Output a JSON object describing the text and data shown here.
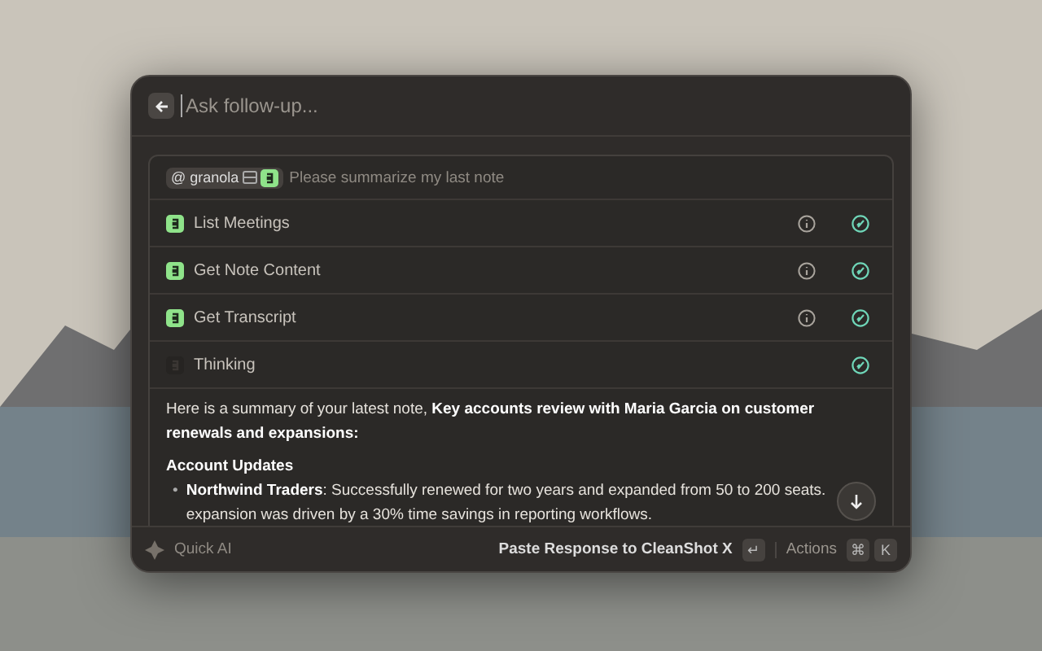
{
  "search": {
    "placeholder": "Ask follow-up..."
  },
  "prompt": {
    "mention": "@ granola",
    "text": "Please summarize my last note"
  },
  "steps": [
    {
      "kind": "tool",
      "label": "List Meetings",
      "done": true
    },
    {
      "kind": "tool",
      "label": "Get Note Content",
      "done": true
    },
    {
      "kind": "tool",
      "label": "Get Transcript",
      "done": true
    },
    {
      "kind": "thinking",
      "label": "Thinking",
      "done": true
    }
  ],
  "answer": {
    "intro": "Here is a summary of your latest note, **Key accounts review with Maria Garcia on customer renewals and expansions:**",
    "heading": "Account Updates",
    "bullets": [
      {
        "marker": "•",
        "text": "**Northwind Traders**: Successfully renewed for two years and expanded from 50 to 200 seats. expansion was driven by a 30% time savings in reporting workflows."
      }
    ]
  },
  "footer": {
    "app": "Quick AI",
    "action": "Paste Response to CleanShot X",
    "action_key": "↵",
    "actions": "Actions",
    "keys": [
      "⌘",
      "K"
    ]
  }
}
